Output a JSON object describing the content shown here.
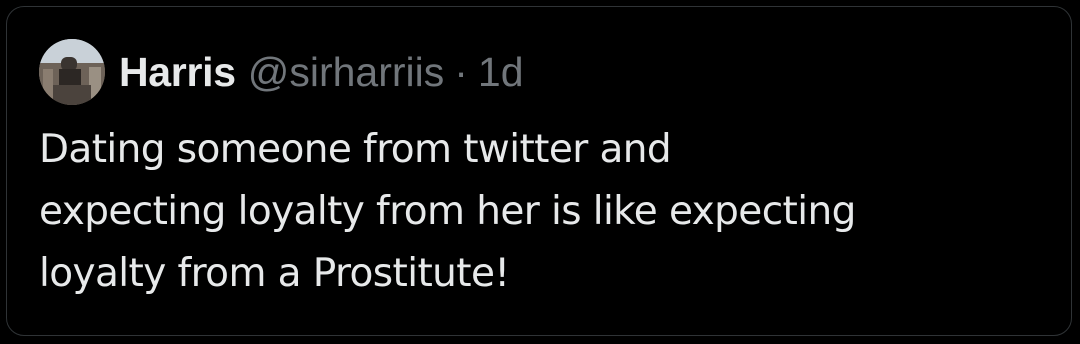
{
  "tweet": {
    "author_name": "Harris",
    "author_handle": "@sirharriis",
    "separator": "·",
    "time": "1d",
    "text_lines": [
      "Dating someone from twitter and",
      "expecting loyalty from her is like expecting",
      "loyalty from a Prostitute!"
    ]
  },
  "colors": {
    "background": "#000000",
    "primary_text": "#e7e9ea",
    "secondary_text": "#71767b",
    "border": "#2f3336"
  },
  "icons": {
    "avatar": "profile-photo"
  }
}
